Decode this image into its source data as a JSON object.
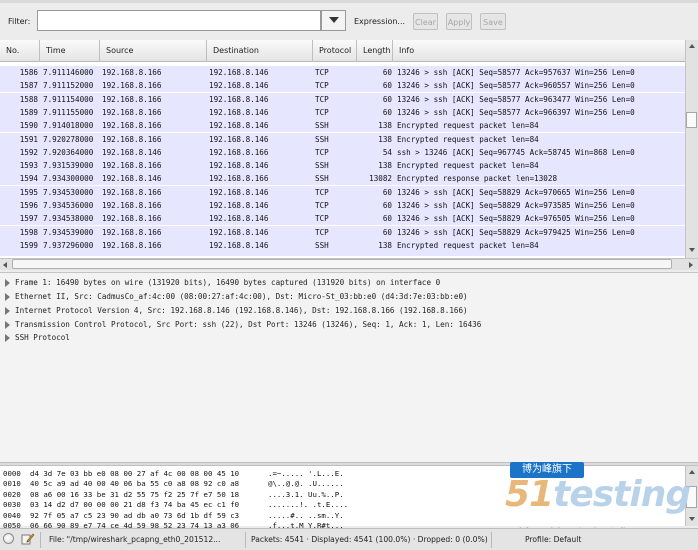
{
  "toolbar": {
    "filter_label": "Filter:",
    "filter_value": "",
    "expression_label": "Expression...",
    "clear_label": "Clear",
    "apply_label": "Apply",
    "save_label": "Save"
  },
  "packet_list": {
    "columns": [
      "No.",
      "Time",
      "Source",
      "Destination",
      "Protocol",
      "Length",
      "Info"
    ],
    "rows": [
      {
        "no": "1586",
        "time": "7.911146000",
        "src": "192.168.8.166",
        "dst": "192.168.8.146",
        "proto": "TCP",
        "len": "60",
        "info": "13246 > ssh [ACK] Seq=58577 Ack=957637 Win=256 Len=0"
      },
      {
        "no": "1587",
        "time": "7.911152000",
        "src": "192.168.8.166",
        "dst": "192.168.8.146",
        "proto": "TCP",
        "len": "60",
        "info": "13246 > ssh [ACK] Seq=58577 Ack=960557 Win=256 Len=0"
      },
      {
        "no": "1588",
        "time": "7.911154000",
        "src": "192.168.8.166",
        "dst": "192.168.8.146",
        "proto": "TCP",
        "len": "60",
        "info": "13246 > ssh [ACK] Seq=58577 Ack=963477 Win=256 Len=0"
      },
      {
        "no": "1589",
        "time": "7.911155000",
        "src": "192.168.8.166",
        "dst": "192.168.8.146",
        "proto": "TCP",
        "len": "60",
        "info": "13246 > ssh [ACK] Seq=58577 Ack=966397 Win=256 Len=0"
      },
      {
        "no": "1590",
        "time": "7.914018000",
        "src": "192.168.8.166",
        "dst": "192.168.8.146",
        "proto": "SSH",
        "len": "138",
        "info": "Encrypted request packet len=84"
      },
      {
        "no": "1591",
        "time": "7.920278000",
        "src": "192.168.8.166",
        "dst": "192.168.8.146",
        "proto": "SSH",
        "len": "138",
        "info": "Encrypted request packet len=84"
      },
      {
        "no": "1592",
        "time": "7.920364000",
        "src": "192.168.8.146",
        "dst": "192.168.8.166",
        "proto": "TCP",
        "len": "54",
        "info": "ssh > 13246 [ACK] Seq=967745 Ack=58745 Win=868 Len=0"
      },
      {
        "no": "1593",
        "time": "7.931539000",
        "src": "192.168.8.166",
        "dst": "192.168.8.146",
        "proto": "SSH",
        "len": "138",
        "info": "Encrypted request packet len=84"
      },
      {
        "no": "1594",
        "time": "7.934300000",
        "src": "192.168.8.146",
        "dst": "192.168.8.166",
        "proto": "SSH",
        "len": "13082",
        "info": "Encrypted response packet len=13028"
      },
      {
        "no": "1595",
        "time": "7.934530000",
        "src": "192.168.8.166",
        "dst": "192.168.8.146",
        "proto": "TCP",
        "len": "60",
        "info": "13246 > ssh [ACK] Seq=58829 Ack=970665 Win=256 Len=0"
      },
      {
        "no": "1596",
        "time": "7.934536000",
        "src": "192.168.8.166",
        "dst": "192.168.8.146",
        "proto": "TCP",
        "len": "60",
        "info": "13246 > ssh [ACK] Seq=58829 Ack=973585 Win=256 Len=0"
      },
      {
        "no": "1597",
        "time": "7.934538000",
        "src": "192.168.8.166",
        "dst": "192.168.8.146",
        "proto": "TCP",
        "len": "60",
        "info": "13246 > ssh [ACK] Seq=58829 Ack=976505 Win=256 Len=0"
      },
      {
        "no": "1598",
        "time": "7.934539000",
        "src": "192.168.8.166",
        "dst": "192.168.8.146",
        "proto": "TCP",
        "len": "60",
        "info": "13246 > ssh [ACK] Seq=58829 Ack=979425 Win=256 Len=0"
      },
      {
        "no": "1599",
        "time": "7.937296000",
        "src": "192.168.8.166",
        "dst": "192.168.8.146",
        "proto": "SSH",
        "len": "138",
        "info": "Encrypted request packet len=84"
      }
    ]
  },
  "details": {
    "items": [
      "Frame 1: 16490 bytes on wire (131920 bits), 16490 bytes captured (131920 bits) on interface 0",
      "Ethernet II, Src: CadmusCo_af:4c:00 (08:00:27:af:4c:00), Dst: Micro-St_03:bb:e0 (d4:3d:7e:03:bb:e0)",
      "Internet Protocol Version 4, Src: 192.168.8.146 (192.168.8.146), Dst: 192.168.8.166 (192.168.8.166)",
      "Transmission Control Protocol, Src Port: ssh (22), Dst Port: 13246 (13246), Seq: 1, Ack: 1, Len: 16436",
      "SSH Protocol"
    ]
  },
  "bytes": {
    "rows": [
      {
        "offset": "0000",
        "hex": "d4 3d 7e 03 bb e0 08 00  27 af 4c 00 08 00 45 10",
        "ascii": ".=~..... '.L...E."
      },
      {
        "offset": "0010",
        "hex": "40 5c a9 ad 40 00 40 06  ba 55 c0 a8 08 92 c0 a8",
        "ascii": "@\\..@.@. .U......"
      },
      {
        "offset": "0020",
        "hex": "08 a6 00 16 33 be 31 d2  55 75 f2 25 7f e7 50 18",
        "ascii": "....3.1. Uu.%..P."
      },
      {
        "offset": "0030",
        "hex": "03 14 d2 d7 00 00 00 21  d8 f3 74 ba 45 ec c1 f0",
        "ascii": ".......!. .t.E...."
      },
      {
        "offset": "0040",
        "hex": "92 7f 05 a7 c5 23 90 ad  db a0 73 6d 1b df 59 c3",
        "ascii": ".....#.. ..sm..Y."
      },
      {
        "offset": "0050",
        "hex": "06 66 90 89 e7 74 ce 4d  59 98 52 23 74 13 a3 06",
        "ascii": ".f...t.M Y.R#t..."
      }
    ]
  },
  "watermark": {
    "banner": "博为峰旗下",
    "logo_pre": "51",
    "logo_mid": "testing",
    "sub": "软件测试网"
  },
  "status": {
    "file": "File: \"/tmp/wireshark_pcapng_eth0_201512...",
    "packets": "Packets: 4541 · Displayed: 4541 (100.0%) · Dropped: 0 (0.0%)",
    "profile": "Profile: Default"
  },
  "icons": {
    "status": "expert-info-icon",
    "edit": "capture-comment-icon",
    "expand": "tree-expand-icon"
  },
  "colors": {
    "row_bg": "#e7e6ff",
    "watermark_blue": "#1c74c8"
  }
}
